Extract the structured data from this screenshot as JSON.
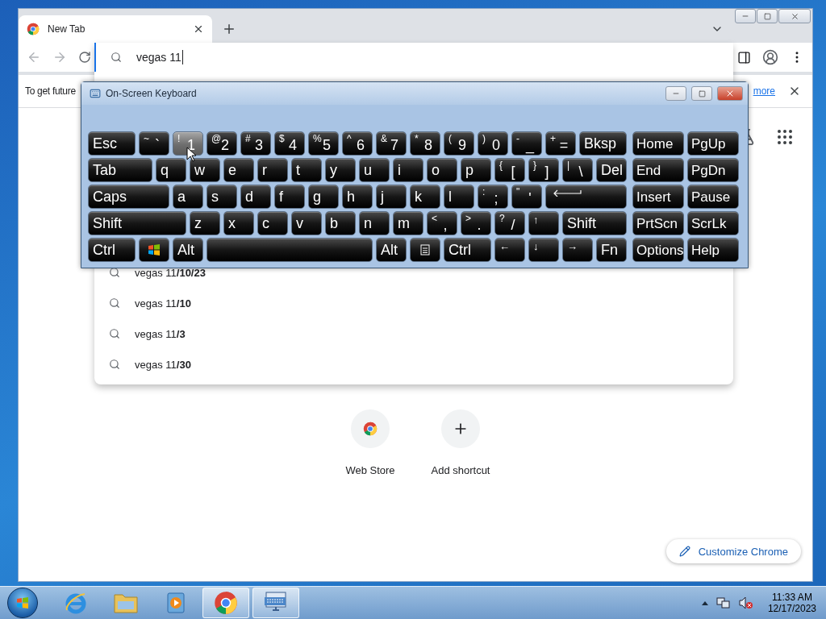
{
  "browser": {
    "tab": {
      "title": "New Tab"
    },
    "omnibox": {
      "value": "vegas 11"
    },
    "suggestions": [
      "vegas 11**/10/23**",
      "vegas 11**/10**",
      "vegas 11**/3**",
      "vegas 11**/30**"
    ],
    "infobar": {
      "text": "To get future",
      "link": "more"
    },
    "shortcuts": [
      {
        "kind": "store",
        "label": "Web Store"
      },
      {
        "kind": "add",
        "label": "Add shortcut"
      }
    ],
    "customize_button": "Customize Chrome"
  },
  "keyboard": {
    "title": "On-Screen Keyboard",
    "main_rows": [
      [
        {
          "kind": "text",
          "label": "Esc",
          "highlighted": false
        },
        {
          "kind": "char",
          "shift": "~",
          "label": "`",
          "highlighted": false
        },
        {
          "kind": "char",
          "shift": "!",
          "label": "1",
          "highlighted": true
        },
        {
          "kind": "char",
          "shift": "@",
          "label": "2",
          "highlighted": false
        },
        {
          "kind": "char",
          "shift": "#",
          "label": "3",
          "highlighted": false
        },
        {
          "kind": "char",
          "shift": "$",
          "label": "4",
          "highlighted": false
        },
        {
          "kind": "char",
          "shift": "%",
          "label": "5",
          "highlighted": false
        },
        {
          "kind": "char",
          "shift": "^",
          "label": "6",
          "highlighted": false
        },
        {
          "kind": "char",
          "shift": "&",
          "label": "7",
          "highlighted": false
        },
        {
          "kind": "char",
          "shift": "*",
          "label": "8",
          "highlighted": false
        },
        {
          "kind": "char",
          "shift": "(",
          "label": "9",
          "highlighted": false
        },
        {
          "kind": "char",
          "shift": ")",
          "label": "0",
          "highlighted": false
        },
        {
          "kind": "char",
          "shift": "-",
          "label": "_",
          "highlighted": false
        },
        {
          "kind": "char",
          "shift": "+",
          "label": "=",
          "highlighted": false
        },
        {
          "kind": "text",
          "label": "Bksp",
          "highlighted": false
        }
      ],
      [
        {
          "kind": "text",
          "label": "Tab",
          "highlighted": false
        },
        {
          "kind": "text",
          "label": "q",
          "highlighted": false
        },
        {
          "kind": "text",
          "label": "w",
          "highlighted": false
        },
        {
          "kind": "text",
          "label": "e",
          "highlighted": false
        },
        {
          "kind": "text",
          "label": "r",
          "highlighted": false
        },
        {
          "kind": "text",
          "label": "t",
          "highlighted": false
        },
        {
          "kind": "text",
          "label": "y",
          "highlighted": false
        },
        {
          "kind": "text",
          "label": "u",
          "highlighted": false
        },
        {
          "kind": "text",
          "label": "i",
          "highlighted": false
        },
        {
          "kind": "text",
          "label": "o",
          "highlighted": false
        },
        {
          "kind": "text",
          "label": "p",
          "highlighted": false
        },
        {
          "kind": "char",
          "shift": "{",
          "label": "[",
          "highlighted": false
        },
        {
          "kind": "char",
          "shift": "}",
          "label": "]",
          "highlighted": false
        },
        {
          "kind": "char",
          "shift": "|",
          "label": "\\",
          "highlighted": false
        },
        {
          "kind": "text",
          "label": "Del",
          "highlighted": false
        }
      ],
      [
        {
          "kind": "text",
          "label": "Caps",
          "highlighted": false
        },
        {
          "kind": "text",
          "label": "a",
          "highlighted": false
        },
        {
          "kind": "text",
          "label": "s",
          "highlighted": false
        },
        {
          "kind": "text",
          "label": "d",
          "highlighted": false
        },
        {
          "kind": "text",
          "label": "f",
          "highlighted": false
        },
        {
          "kind": "text",
          "label": "g",
          "highlighted": false
        },
        {
          "kind": "text",
          "label": "h",
          "highlighted": false
        },
        {
          "kind": "text",
          "label": "j",
          "highlighted": false
        },
        {
          "kind": "text",
          "label": "k",
          "highlighted": false
        },
        {
          "kind": "text",
          "label": "l",
          "highlighted": false
        },
        {
          "kind": "char",
          "shift": ":",
          "label": ";",
          "highlighted": false
        },
        {
          "kind": "char",
          "shift": "\"",
          "label": "'",
          "highlighted": false
        },
        {
          "kind": "enter",
          "highlighted": false
        }
      ],
      [
        {
          "kind": "text",
          "label": "Shift",
          "highlighted": false
        },
        {
          "kind": "text",
          "label": "z",
          "highlighted": false
        },
        {
          "kind": "text",
          "label": "x",
          "highlighted": false
        },
        {
          "kind": "text",
          "label": "c",
          "highlighted": false
        },
        {
          "kind": "text",
          "label": "v",
          "highlighted": false
        },
        {
          "kind": "text",
          "label": "b",
          "highlighted": false
        },
        {
          "kind": "text",
          "label": "n",
          "highlighted": false
        },
        {
          "kind": "text",
          "label": "m",
          "highlighted": false
        },
        {
          "kind": "char",
          "shift": "<",
          "label": ",",
          "highlighted": false
        },
        {
          "kind": "char",
          "shift": ">",
          "label": ".",
          "highlighted": false
        },
        {
          "kind": "char",
          "shift": "?",
          "label": "/",
          "highlighted": false
        },
        {
          "kind": "arrow",
          "label": "↑",
          "highlighted": false
        },
        {
          "kind": "text",
          "label": "Shift",
          "highlighted": false
        }
      ],
      [
        {
          "kind": "text",
          "label": "Ctrl",
          "highlighted": false
        },
        {
          "kind": "win",
          "highlighted": false
        },
        {
          "kind": "text",
          "label": "Alt",
          "highlighted": false
        },
        {
          "kind": "space",
          "highlighted": false
        },
        {
          "kind": "text",
          "label": "Alt",
          "highlighted": false
        },
        {
          "kind": "menu",
          "highlighted": false
        },
        {
          "kind": "text",
          "label": "Ctrl",
          "highlighted": false
        },
        {
          "kind": "arrow",
          "label": "←",
          "highlighted": false
        },
        {
          "kind": "arrow",
          "label": "↓",
          "highlighted": false
        },
        {
          "kind": "arrow",
          "label": "→",
          "highlighted": false
        },
        {
          "kind": "text",
          "label": "Fn",
          "highlighted": false
        }
      ]
    ],
    "nav_rows": [
      [
        "Home",
        "PgUp"
      ],
      [
        "End",
        "PgDn"
      ],
      [
        "Insert",
        "Pause"
      ],
      [
        "PrtScn",
        "ScrLk"
      ],
      [
        "Options",
        "Help"
      ]
    ]
  },
  "taskbar": {
    "apps": [
      {
        "kind": "ie",
        "running": false
      },
      {
        "kind": "explorer",
        "running": false
      },
      {
        "kind": "media",
        "running": false
      },
      {
        "kind": "chrome",
        "running": true
      },
      {
        "kind": "keyboard",
        "running": true
      }
    ],
    "time": "11:33 AM",
    "date": "12/17/2023"
  }
}
